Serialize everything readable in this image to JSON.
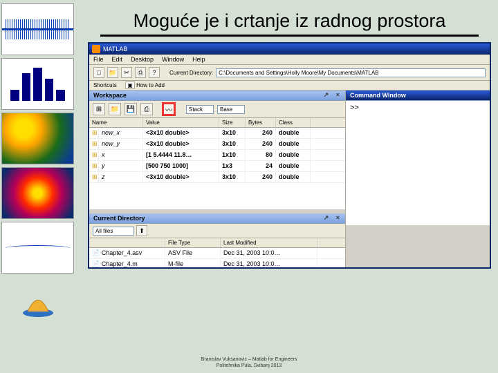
{
  "slide": {
    "title": "Moguće je i crtanje iz radnog prostora",
    "footer1": "Branislav Vuksanovic – Matlab for Engineers",
    "footer2": "Politehnika Pula, Svibanj 2013"
  },
  "matlab": {
    "app_title": "MATLAB",
    "menu": [
      "File",
      "Edit",
      "Desktop",
      "Window",
      "Help"
    ],
    "curdir_label": "Current Directory:",
    "curdir_value": "C:\\Documents and Settings\\Holly Moore\\My Documents\\MATLAB",
    "shortcuts_label": "Shortcuts",
    "shortcuts_link": "How to Add",
    "workspace": {
      "title": "Workspace",
      "tooltitles": {
        "stack": "Stack",
        "base": "Base"
      },
      "columns": [
        "Name",
        "Value",
        "Size",
        "Bytes",
        "Class"
      ],
      "rows": [
        {
          "name": "new_x",
          "value": "<3x10 double>",
          "size": "3x10",
          "bytes": "240",
          "class": "double"
        },
        {
          "name": "new_y",
          "value": "<3x10 double>",
          "size": "3x10",
          "bytes": "240",
          "class": "double"
        },
        {
          "name": "x",
          "value": "[1 5.4444 11.8…",
          "size": "1x10",
          "bytes": "80",
          "class": "double"
        },
        {
          "name": "y",
          "value": "[500 750 1000]",
          "size": "1x3",
          "bytes": "24",
          "class": "double"
        },
        {
          "name": "z",
          "value": "<3x10 double>",
          "size": "3x10",
          "bytes": "240",
          "class": "double"
        }
      ]
    },
    "curdir_panel": {
      "title": "Current Directory",
      "filter": "All files",
      "columns": [
        "",
        "File Type",
        "Last Modified"
      ],
      "rows": [
        {
          "name": "Chapter_4.asv",
          "type": "ASV File",
          "mod": "Dec 31, 2003 10:0…"
        },
        {
          "name": "Chapter_4.m",
          "type": "M-file",
          "mod": "Dec 31, 2003 10:0…"
        }
      ]
    },
    "command": {
      "title": "Command Window",
      "prompt": ">>"
    }
  },
  "icons": {
    "var": "⊞",
    "plot": "〰",
    "new": "□",
    "open": "📁",
    "save": "💾",
    "cut": "✂",
    "print": "⎙",
    "help": "?"
  }
}
